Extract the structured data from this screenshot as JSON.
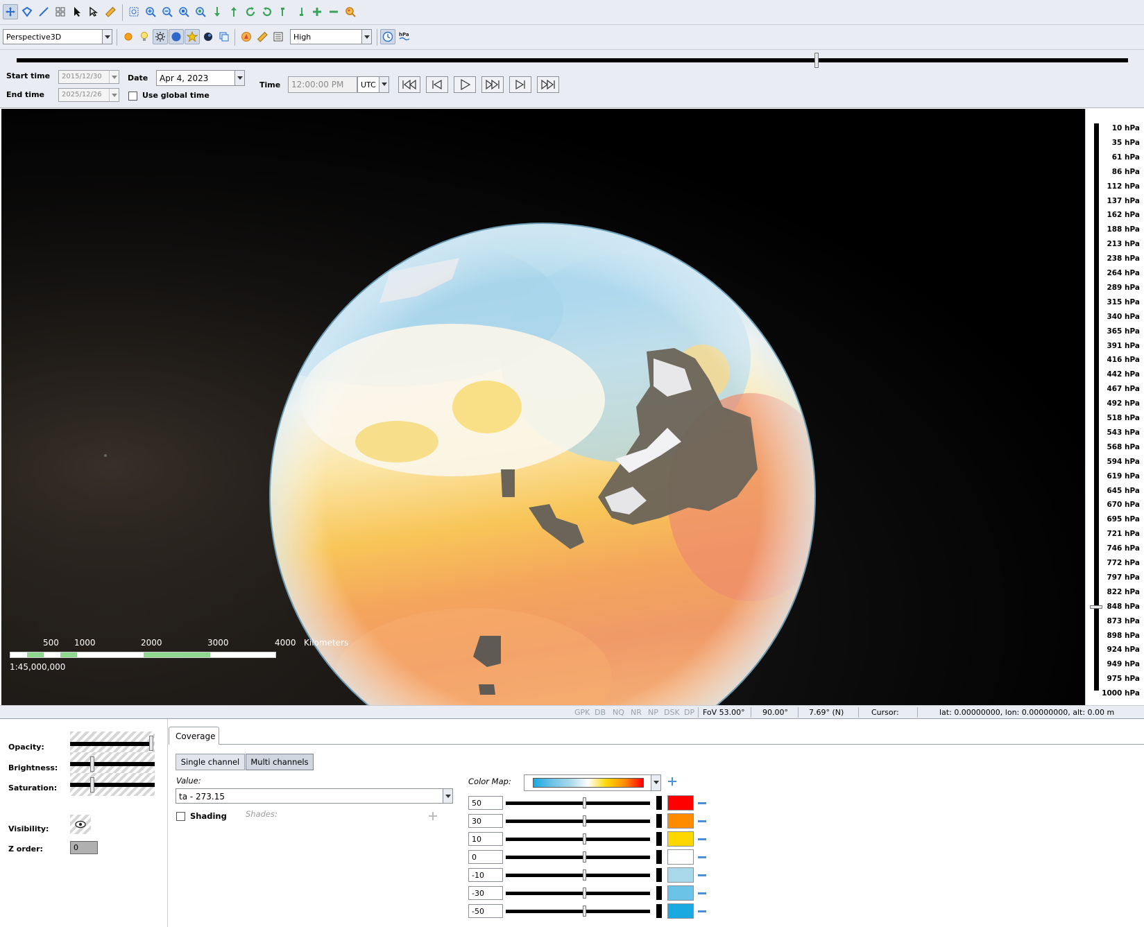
{
  "toolbar": {
    "icons": [
      "pan-icon",
      "draw-polygon-icon",
      "draw-line-icon",
      "grid-icon",
      "select-arrow-icon",
      "pick-icon",
      "measure-icon",
      "zoom-box-icon",
      "zoom-in-icon",
      "zoom-out-icon",
      "zoom-layer-icon",
      "zoom-full-icon",
      "arrow-down-icon",
      "arrow-up-icon",
      "refresh-icon",
      "rotate-icon",
      "tilt-left-icon",
      "tilt-right-icon",
      "add-icon",
      "remove-icon",
      "globe-search-icon"
    ],
    "projection": "Perspective3D",
    "quality": "High"
  },
  "time": {
    "start_time_label": "Start time",
    "start_time_value": "2015/12/30",
    "end_time_label": "End time",
    "end_time_value": "2025/12/26",
    "date_label": "Date",
    "date_value": "Apr 4, 2023",
    "use_global_time": "Use global time",
    "time_label": "Time",
    "time_value": "12:00:00 PM",
    "timezone": "UTC",
    "slider_position": 0.72
  },
  "scalebar": {
    "ticks": [
      "500",
      "1000",
      "2000",
      "3000",
      "4000"
    ],
    "unit": "Kilometers",
    "scale": "1:45,000,000"
  },
  "pressure_levels": [
    "10 hPa",
    "35 hPa",
    "61 hPa",
    "86 hPa",
    "112 hPa",
    "137 hPa",
    "162 hPa",
    "188 hPa",
    "213 hPa",
    "238 hPa",
    "264 hPa",
    "289 hPa",
    "315 hPa",
    "340 hPa",
    "365 hPa",
    "391 hPa",
    "416 hPa",
    "442 hPa",
    "467 hPa",
    "492 hPa",
    "518 hPa",
    "543 hPa",
    "568 hPa",
    "594 hPa",
    "619 hPa",
    "645 hPa",
    "670 hPa",
    "695 hPa",
    "721 hPa",
    "746 hPa",
    "772 hPa",
    "797 hPa",
    "822 hPa",
    "848 hPa",
    "873 hPa",
    "898 hPa",
    "924 hPa",
    "949 hPa",
    "975 hPa",
    "1000 hPa"
  ],
  "pressure_selected": "848 hPa",
  "status": {
    "flags": [
      "GPK",
      "DB",
      "NQ",
      "NR",
      "NP",
      "DSK",
      "DP"
    ],
    "fov": "FoV 53.00°",
    "heading": "90.00°",
    "pitch": "7.69° (N)",
    "cursor_label": "Cursor:",
    "position": "lat: 0.00000000, lon: 0.00000000, alt: 0.00 m"
  },
  "layer_props": {
    "opacity_label": "Opacity:",
    "brightness_label": "Brightness:",
    "saturation_label": "Saturation:",
    "visibility_label": "Visibility:",
    "zorder_label": "Z order:",
    "zorder_value": "0",
    "opacity": 1.0,
    "brightness": 0.5,
    "saturation": 0.5
  },
  "coverage": {
    "tab": "Coverage",
    "single_channel": "Single channel",
    "multi_channels": "Multi channels",
    "value_label": "Value:",
    "value": "ta - 273.15",
    "shading_label": "Shading",
    "shades_label": "Shades:",
    "color_map_label": "Color Map:",
    "stops": [
      {
        "value": "50",
        "color": "#ff0000"
      },
      {
        "value": "30",
        "color": "#ff8c00"
      },
      {
        "value": "10",
        "color": "#ffd700"
      },
      {
        "value": "0",
        "color": "#ffffff"
      },
      {
        "value": "-10",
        "color": "#a8d8ea"
      },
      {
        "value": "-30",
        "color": "#6cc3e8"
      },
      {
        "value": "-50",
        "color": "#1aa9e0"
      }
    ]
  },
  "colors": {
    "accent": "#4a90d9",
    "toolbar_bg": "#e9edf3"
  }
}
